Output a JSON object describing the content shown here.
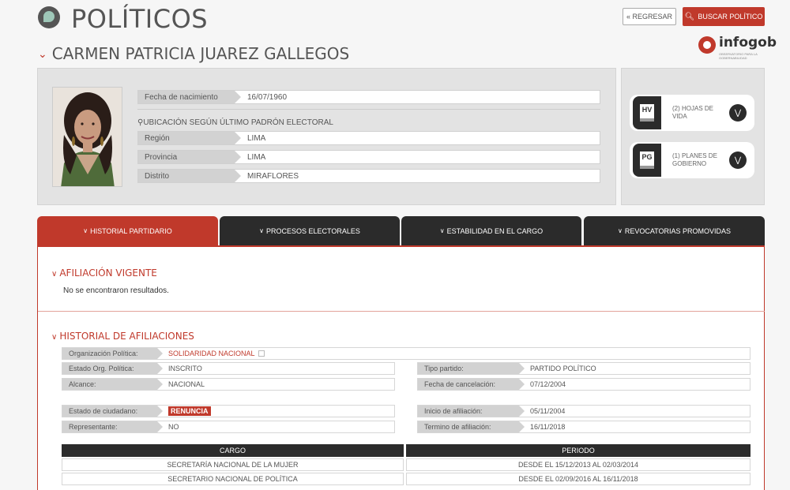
{
  "header": {
    "title": "POLÍTICOS",
    "person_name": "CARMEN PATRICIA JUAREZ GALLEGOS",
    "back_button": "« REGRESAR",
    "search_button": "BUSCAR POLÍTICO",
    "brand": "infogob",
    "brand_sub": "OBSERVATORIO PARA LA GOBERNABILIDAD"
  },
  "profile": {
    "birth_label": "Fecha de nacimiento",
    "birth_value": "16/07/1960",
    "location_title": "UBICACIÓN SEGÚN ÚLTIMO PADRÓN ELECTORAL",
    "region_label": "Región",
    "region_value": "LIMA",
    "province_label": "Provincia",
    "province_value": "LIMA",
    "district_label": "Distrito",
    "district_value": "MIRAFLORES"
  },
  "documents": [
    {
      "code": "HV",
      "text": "(2) HOJAS DE VIDA"
    },
    {
      "code": "PG",
      "text": "(1) PLANES DE GOBIERNO"
    }
  ],
  "tabs": [
    {
      "label": "HISTORIAL PARTIDARIO",
      "active": true
    },
    {
      "label": "PROCESOS ELECTORALES",
      "active": false
    },
    {
      "label": "ESTABILIDAD EN EL CARGO",
      "active": false
    },
    {
      "label": "REVOCATORIAS PROMOVIDAS",
      "active": false
    }
  ],
  "current_affiliation": {
    "title": "AFILIACIÓN VIGENTE",
    "message": "No se encontraron resultados."
  },
  "history": {
    "title": "HISTORIAL DE AFILIACIONES",
    "org_label": "Organización Política:",
    "org_value": "SOLIDARIDAD NACIONAL",
    "state_label": "Estado Org. Política:",
    "state_value": "INSCRITO",
    "party_type_label": "Tipo partido:",
    "party_type_value": "PARTIDO POLÍTICO",
    "scope_label": "Alcance:",
    "scope_value": "NACIONAL",
    "cancel_label": "Fecha de cancelación:",
    "cancel_value": "07/12/2004",
    "citizen_state_label": "Estado de ciudadano:",
    "citizen_state_value": "RENUNCIA",
    "start_label": "Inicio de afiliación:",
    "start_value": "05/11/2004",
    "rep_label": "Representante:",
    "rep_value": "NO",
    "end_label": "Termino de afiliación:",
    "end_value": "16/11/2018",
    "table": {
      "col_cargo": "CARGO",
      "col_periodo": "PERIODO",
      "rows": [
        {
          "cargo": "SECRETARÍA NACIONAL DE LA MUJER",
          "periodo": "DESDE EL 15/12/2013 AL 02/03/2014"
        },
        {
          "cargo": "SECRETARIO NACIONAL DE POLÍTICA",
          "periodo": "DESDE EL 02/09/2016 AL 16/11/2018"
        }
      ]
    }
  },
  "colors": {
    "accent": "#c0392b",
    "dark": "#2b2b2b",
    "label_bg": "#d2d2d2"
  }
}
